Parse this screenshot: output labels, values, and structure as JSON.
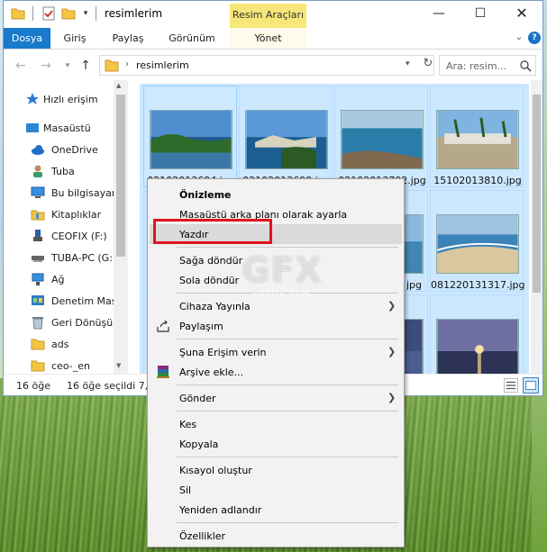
{
  "window": {
    "title": "resimlerim",
    "context_tab": "Resim Araçları",
    "controls": {
      "minimize": "—",
      "maximize": "☐",
      "close": "✕"
    }
  },
  "ribbon": {
    "tabs": [
      "Dosya",
      "Giriş",
      "Paylaş",
      "Görünüm",
      "Yönet"
    ],
    "help": "?"
  },
  "address": {
    "path": "resimlerim",
    "search_placeholder": "Ara: resim..."
  },
  "nav_pane": {
    "items": [
      {
        "label": "Hızlı erişim",
        "icon": "star-icon"
      },
      {
        "label": "Masaüstü",
        "icon": "desktop-icon"
      },
      {
        "label": "OneDrive",
        "icon": "cloud-icon"
      },
      {
        "label": "Tuba",
        "icon": "user-icon"
      },
      {
        "label": "Bu bilgisayar",
        "icon": "computer-icon"
      },
      {
        "label": "Kitaplıklar",
        "icon": "library-icon"
      },
      {
        "label": "CEOFIX (F:)",
        "icon": "usb-drive-icon"
      },
      {
        "label": "TUBA-PC (G:",
        "icon": "drive-icon"
      },
      {
        "label": "Ağ",
        "icon": "network-icon"
      },
      {
        "label": "Denetim Mas",
        "icon": "control-panel-icon"
      },
      {
        "label": "Geri Dönüşür",
        "icon": "recycle-bin-icon"
      },
      {
        "label": "ads",
        "icon": "folder-icon"
      },
      {
        "label": "ceo-_en",
        "icon": "folder-icon"
      }
    ]
  },
  "files": [
    {
      "name": "02102013694.jpg"
    },
    {
      "name": "02102013699.jpg"
    },
    {
      "name": "02102013702.jpg"
    },
    {
      "name": "15102013810.jpg"
    },
    {
      "name": ""
    },
    {
      "name": ""
    },
    {
      "name": "jpg"
    },
    {
      "name": "081220131317.jpg"
    },
    {
      "name": ""
    },
    {
      "name": ""
    },
    {
      "name": ""
    },
    {
      "name": ""
    }
  ],
  "status": {
    "count": "16 öğe",
    "selected": "16 öğe seçildi  7,3"
  },
  "context_menu": {
    "items": [
      {
        "label": "Önizleme",
        "bold": true
      },
      {
        "label": "Masaüstü arka planı olarak ayarla"
      },
      {
        "label": "Yazdır",
        "highlighted": true
      },
      {
        "label": "Sağa döndür"
      },
      {
        "label": "Sola döndür"
      },
      {
        "label": "Cihaza Yayınla",
        "submenu": true
      },
      {
        "label": "Paylaşım",
        "icon": "share-icon"
      },
      {
        "label": "Şuna Erişim verin",
        "submenu": true
      },
      {
        "label": "Arşive ekle...",
        "icon": "winrar-icon"
      },
      {
        "label": "Gönder",
        "submenu": true
      },
      {
        "label": "Kes"
      },
      {
        "label": "Kopyala"
      },
      {
        "label": "Kısayol oluştur"
      },
      {
        "label": "Sil"
      },
      {
        "label": "Yeniden adlandır"
      },
      {
        "label": "Özellikler"
      }
    ],
    "highlight_color": "#e0141e"
  },
  "watermark": {
    "logo": "GFX",
    "sub": "ceofix.com"
  },
  "colors": {
    "file_tab": "#1979ca",
    "context_tab": "#f7e67a",
    "selection": "#cce8ff"
  }
}
